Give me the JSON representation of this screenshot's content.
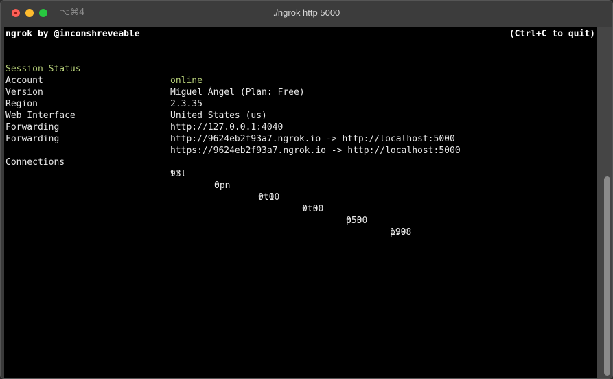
{
  "window": {
    "title": "./ngrok http 5000",
    "shortcut": "⌥⌘4",
    "buttons": {
      "close": "close",
      "minimize": "minimize",
      "maximize": "maximize"
    }
  },
  "terminal": {
    "header": {
      "title": "ngrok by @inconshreveable",
      "quit_hint": "(Ctrl+C to quit)"
    },
    "session": [
      {
        "label": "Session Status",
        "value": "online",
        "highlight": true
      },
      {
        "label": "Account",
        "value": "Miguel Ángel (Plan: Free)"
      },
      {
        "label": "Version",
        "value": "2.3.35"
      },
      {
        "label": "Region",
        "value": "United States (us)"
      },
      {
        "label": "Web Interface",
        "value": "http://127.0.0.1:4040"
      },
      {
        "label": "Forwarding",
        "value": "http://9624eb2f93a7.ngrok.io -> http://localhost:5000"
      },
      {
        "label": "Forwarding",
        "value": "https://9624eb2f93a7.ngrok.io -> http://localhost:5000"
      }
    ],
    "connections": {
      "label": "Connections",
      "headers": [
        "ttl",
        "opn",
        "rt1",
        "rt5",
        "p50",
        "p90"
      ],
      "values": [
        "93",
        "0",
        "0.00",
        "0.00",
        "0.30",
        "1.98"
      ]
    }
  },
  "colors": {
    "status_green": "#b6cf79",
    "terminal_bg": "#000000",
    "close": "#fe5f57",
    "minimize": "#febc2e",
    "maximize": "#28c840"
  }
}
